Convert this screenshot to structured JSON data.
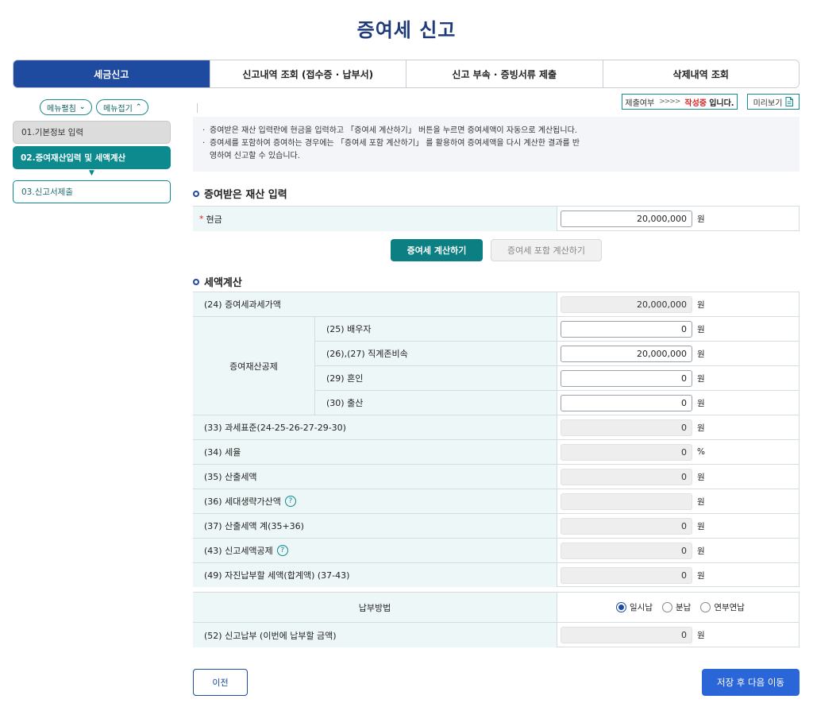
{
  "page_title": "증여세 신고",
  "tabs": [
    {
      "label": "세금신고",
      "active": true
    },
    {
      "label": "신고내역 조회 (접수증 · 납부서)",
      "active": false
    },
    {
      "label": "신고 부속 · 증빙서류 제출",
      "active": false
    },
    {
      "label": "삭제내역 조회",
      "active": false
    }
  ],
  "sidebar": {
    "expand_label": "메뉴펼침",
    "collapse_label": "메뉴접기",
    "steps": [
      {
        "label": "01.기본정보 입력"
      },
      {
        "label": "02.증여재산입력 및 세액계산"
      },
      {
        "label": "03.신고서제출"
      }
    ]
  },
  "status": {
    "label": "제출여부",
    "arrows": ">>>>",
    "state": "작성중",
    "suffix": "입니다."
  },
  "preview_label": "미리보기",
  "notice": [
    "증여받은 재산 입력란에 현금을 입력하고 「증여세 계산하기」 버튼을 누르면 증여세액이 자동으로 계산됩니다.",
    "증여세를 포함하여 증여하는 경우에는 「증여세 포함 계산하기」 를 활용하여 증여세액을 다시 계산한 결과를 반영하여 신고할 수 있습니다."
  ],
  "section_input": {
    "title": "증여받은 재산 입력",
    "cash_label": "현금",
    "required_mark": "*",
    "cash_value": "20,000,000",
    "unit": "원"
  },
  "buttons": {
    "calc": "증여세 계산하기",
    "calc_incl": "증여세 포함 계산하기",
    "prev": "이전",
    "next": "저장 후 다음 이동"
  },
  "section_calc": {
    "title": "세액계산",
    "row24": {
      "label": "(24) 증여세과세가액",
      "value": "20,000,000",
      "unit": "원"
    },
    "group_label": "증여재산공제",
    "row25": {
      "label": "(25) 배우자",
      "value": "0",
      "unit": "원"
    },
    "row2627": {
      "label": "(26),(27) 직계존비속",
      "value": "20,000,000",
      "unit": "원"
    },
    "row29": {
      "label": "(29) 혼인",
      "value": "0",
      "unit": "원"
    },
    "row30": {
      "label": "(30) 출산",
      "value": "0",
      "unit": "원"
    },
    "row33": {
      "label": "(33) 과세표준(24-25-26-27-29-30)",
      "value": "0",
      "unit": "원"
    },
    "row34": {
      "label": "(34) 세율",
      "value": "0",
      "unit": "%"
    },
    "row35": {
      "label": "(35) 산출세액",
      "value": "0",
      "unit": "원"
    },
    "row36": {
      "label": "(36) 세대생략가산액",
      "value": "",
      "unit": "원"
    },
    "row37": {
      "label": "(37) 산출세액 계(35+36)",
      "value": "0",
      "unit": "원"
    },
    "row43": {
      "label": "(43) 신고세액공제",
      "value": "0",
      "unit": "원"
    },
    "row49": {
      "label": "(49) 자진납부할 세액(합계액) (37-43)",
      "value": "0",
      "unit": "원"
    }
  },
  "payment": {
    "label": "납부방법",
    "options": [
      "일시납",
      "분납",
      "연부연납"
    ],
    "selected": "일시납",
    "row52": {
      "label": "(52) 신고납부 (이번에 납부할 금액)",
      "value": "0",
      "unit": "원"
    }
  },
  "help_glyph": "?",
  "colors": {
    "primary": "#1e4aa0",
    "teal": "#0c8a8e",
    "title": "#1e3a78",
    "status_red": "#d4262a"
  }
}
